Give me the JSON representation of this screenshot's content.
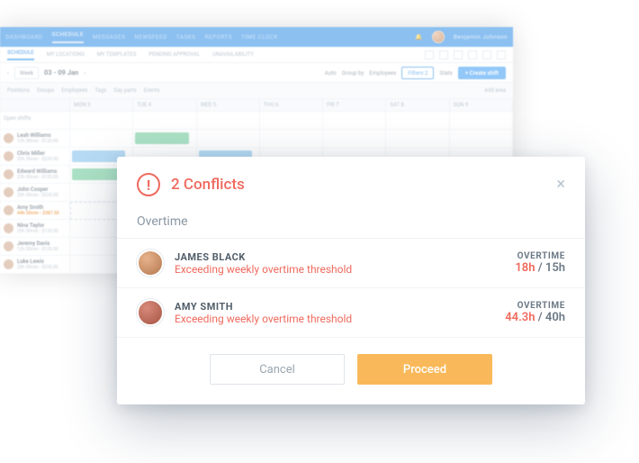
{
  "topnav": {
    "items": [
      "DASHBOARD",
      "SCHEDULE",
      "MESSAGES",
      "NEWSFEED",
      "TASKS",
      "REPORTS",
      "TIME CLOCK"
    ],
    "active_index": 1,
    "user_name": "Benjamin Johnson"
  },
  "subnav": {
    "items": [
      "SCHEDULE",
      "MY LOCATIONS",
      "MY TEMPLATES",
      "PENDING APPROVAL",
      "UNAVAILABILITY"
    ],
    "active_index": 0
  },
  "toolbar": {
    "view_label": "Week",
    "date_range": "03 - 09 Jan",
    "auto_label": "Auto",
    "group_label": "Group by",
    "group_value": "Employees",
    "filters_label": "Filters",
    "filters_count": "2",
    "stats_label": "Stats",
    "create_label": "+  Create shift"
  },
  "filters_row": {
    "positions": "Positions",
    "groups": "Groups",
    "employees": "Employees",
    "tags": "Tags",
    "dayparts": "Day parts",
    "events": "Events",
    "add_area": "Add area"
  },
  "grid": {
    "day_headers": [
      "MON 3",
      "TUE 4",
      "WED 5",
      "THU 6",
      "FRI 7",
      "SAT 8",
      "SUN 9"
    ],
    "open_label": "Open shifts",
    "employees": [
      {
        "name": "Leah Williams",
        "meta": "12h 30min - $120.00"
      },
      {
        "name": "Chris Miller",
        "meta": "20h 30min - $320.00"
      },
      {
        "name": "Edward Williams",
        "meta": "22h 30min - $120.00"
      },
      {
        "name": "John Cooper",
        "meta": "20h 30min - $320.00"
      },
      {
        "name": "Amy Smith",
        "meta": "44h 30min - $387.50",
        "highlight": true
      },
      {
        "name": "Nina Taylor",
        "meta": "20h 30min - $120.00"
      },
      {
        "name": "Jeremy Davis",
        "meta": "12h 30min - $120.00"
      },
      {
        "name": "Luke Lewis",
        "meta": "20h 30min - $320.00"
      }
    ]
  },
  "modal": {
    "title": "2 Conflicts",
    "section": "Overtime",
    "rows": [
      {
        "name": "JAMES BLACK",
        "message": "Exceeding weekly overtime threshold",
        "ot_label": "OVERTIME",
        "ot_hot": "18h",
        "ot_sep": " / ",
        "ot_limit": "15h"
      },
      {
        "name": "AMY SMITH",
        "message": "Exceeding weekly overtime threshold",
        "ot_label": "OVERTIME",
        "ot_hot": "44.3h",
        "ot_sep": " / ",
        "ot_limit": "40h"
      }
    ],
    "cancel": "Cancel",
    "proceed": "Proceed"
  }
}
